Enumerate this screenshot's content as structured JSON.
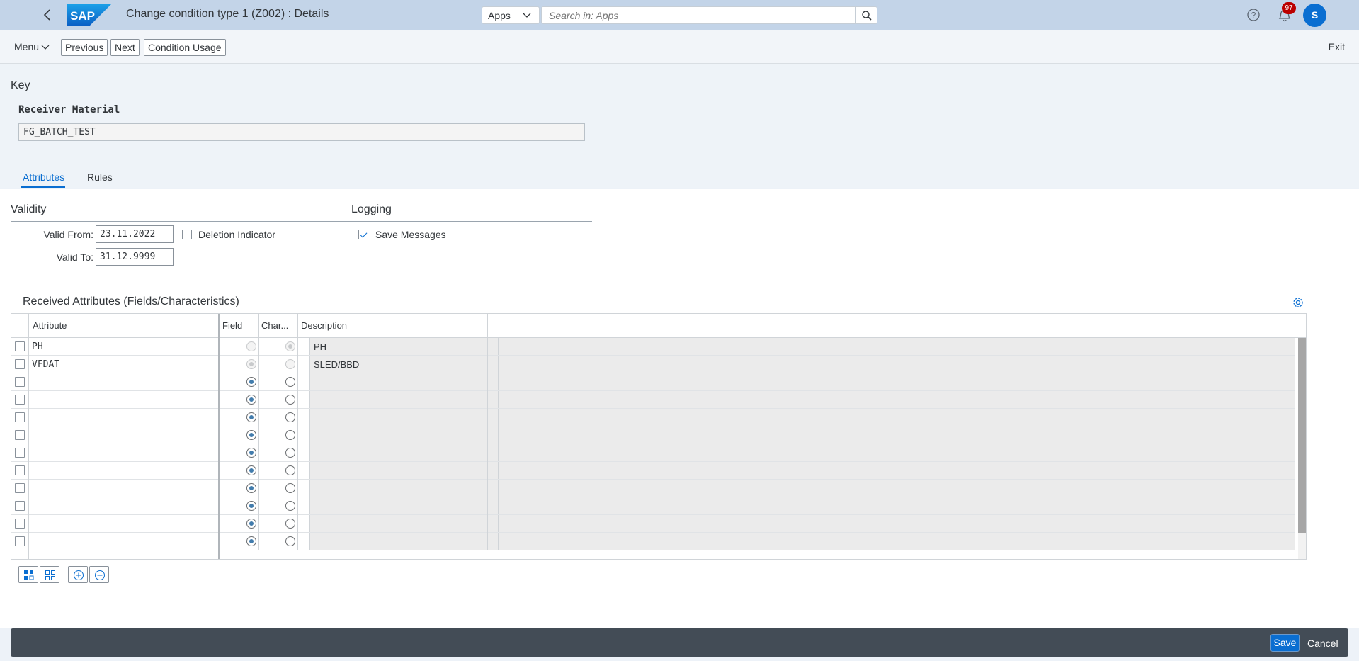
{
  "shell": {
    "title": "Change condition type 1 (Z002) : Details",
    "logo_text": "SAP",
    "apps_label": "Apps",
    "search_placeholder": "Search in: Apps",
    "notification_count": "97",
    "user_initial": "S"
  },
  "toolbar": {
    "menu_label": "Menu",
    "previous_label": "Previous",
    "next_label": "Next",
    "condition_usage_label": "Condition Usage",
    "exit_label": "Exit"
  },
  "key": {
    "title": "Key",
    "field_label": "Receiver Material",
    "field_value": "FG_BATCH_TEST"
  },
  "tabs": [
    {
      "label": "Attributes",
      "selected": true
    },
    {
      "label": "Rules",
      "selected": false
    }
  ],
  "validity": {
    "title": "Validity",
    "valid_from_label": "Valid From:",
    "valid_from_value": "23.11.2022",
    "valid_to_label": "Valid To:",
    "valid_to_value": "31.12.9999",
    "deletion_indicator_label": "Deletion Indicator",
    "deletion_indicator_checked": false
  },
  "logging": {
    "title": "Logging",
    "save_messages_label": "Save Messages",
    "save_messages_checked": true
  },
  "table": {
    "title": "Received Attributes (Fields/Characteristics)",
    "columns": [
      "Attribute",
      "Field",
      "Char...",
      "Description"
    ],
    "rows": [
      {
        "attribute": "PH",
        "field": false,
        "char": true,
        "description": "PH",
        "disabled": true
      },
      {
        "attribute": "VFDAT",
        "field": true,
        "char": false,
        "description": "SLED/BBD",
        "disabled": true
      },
      {
        "attribute": "",
        "field": true,
        "char": false,
        "description": "",
        "disabled": false
      },
      {
        "attribute": "",
        "field": true,
        "char": false,
        "description": "",
        "disabled": false
      },
      {
        "attribute": "",
        "field": true,
        "char": false,
        "description": "",
        "disabled": false
      },
      {
        "attribute": "",
        "field": true,
        "char": false,
        "description": "",
        "disabled": false
      },
      {
        "attribute": "",
        "field": true,
        "char": false,
        "description": "",
        "disabled": false
      },
      {
        "attribute": "",
        "field": true,
        "char": false,
        "description": "",
        "disabled": false
      },
      {
        "attribute": "",
        "field": true,
        "char": false,
        "description": "",
        "disabled": false
      },
      {
        "attribute": "",
        "field": true,
        "char": false,
        "description": "",
        "disabled": false
      },
      {
        "attribute": "",
        "field": true,
        "char": false,
        "description": "",
        "disabled": false
      },
      {
        "attribute": "",
        "field": true,
        "char": false,
        "description": "",
        "disabled": false
      }
    ]
  },
  "footer": {
    "save_label": "Save",
    "cancel_label": "Cancel"
  },
  "colors": {
    "shell_bg": "#c3d4e8",
    "accent": "#0a6ed1",
    "footer_bg": "#434c56",
    "badge": "#bb0000"
  },
  "icons": [
    "back-icon",
    "sap-logo",
    "chevron-down-icon",
    "search-icon",
    "help-icon",
    "bell-icon",
    "settings-icon",
    "select-all-icon",
    "deselect-all-icon",
    "add-row-icon",
    "remove-row-icon"
  ]
}
